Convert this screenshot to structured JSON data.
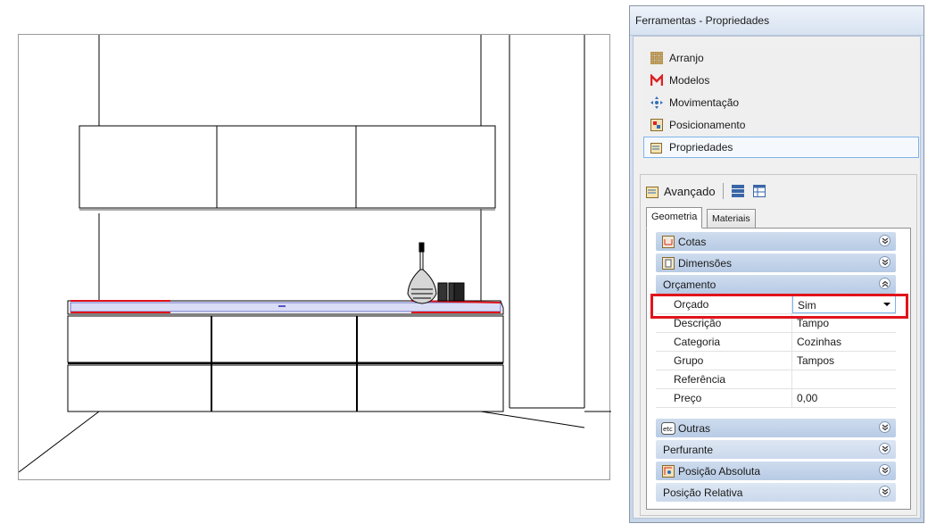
{
  "panel": {
    "title": "Ferramentas - Propriedades",
    "nav": [
      {
        "label": "Arranjo",
        "icon": "grid-icon"
      },
      {
        "label": "Modelos",
        "icon": "models-m-icon"
      },
      {
        "label": "Movimentação",
        "icon": "move-arrows-icon"
      },
      {
        "label": "Posicionamento",
        "icon": "positioning-icon"
      },
      {
        "label": "Propriedades",
        "icon": "properties-icon",
        "selected": true
      }
    ],
    "advanced": {
      "label": "Avançado",
      "tabs": [
        "Geometria",
        "Materiais"
      ],
      "active_tab": "Geometria",
      "categories_top": [
        {
          "label": "Cotas",
          "icon": "dimensions-icon"
        },
        {
          "label": "Dimensões",
          "icon": "sizes-icon"
        }
      ],
      "orcamento": {
        "label": "Orçamento",
        "rows": [
          {
            "name": "Orçado",
            "value": "Sim"
          },
          {
            "name": "Descrição",
            "value": "Tampo"
          },
          {
            "name": "Categoria",
            "value": "Cozinhas"
          },
          {
            "name": "Grupo",
            "value": "Tampos"
          },
          {
            "name": "Referência",
            "value": ""
          },
          {
            "name": "Preço",
            "value": "0,00"
          }
        ]
      },
      "categories_bottom": [
        {
          "label": "Outras",
          "icon": "etc-icon"
        },
        {
          "label": "Perfurante",
          "icon": ""
        },
        {
          "label": "Posição Absoluta",
          "icon": "absolute-position-icon"
        },
        {
          "label": "Posição Relativa",
          "icon": ""
        }
      ]
    }
  },
  "colors": {
    "highlight": "#e0141c",
    "accent": "#7eb4ea",
    "selection_red": "#e0141c",
    "countertop_fill": "#d9dcf5"
  }
}
